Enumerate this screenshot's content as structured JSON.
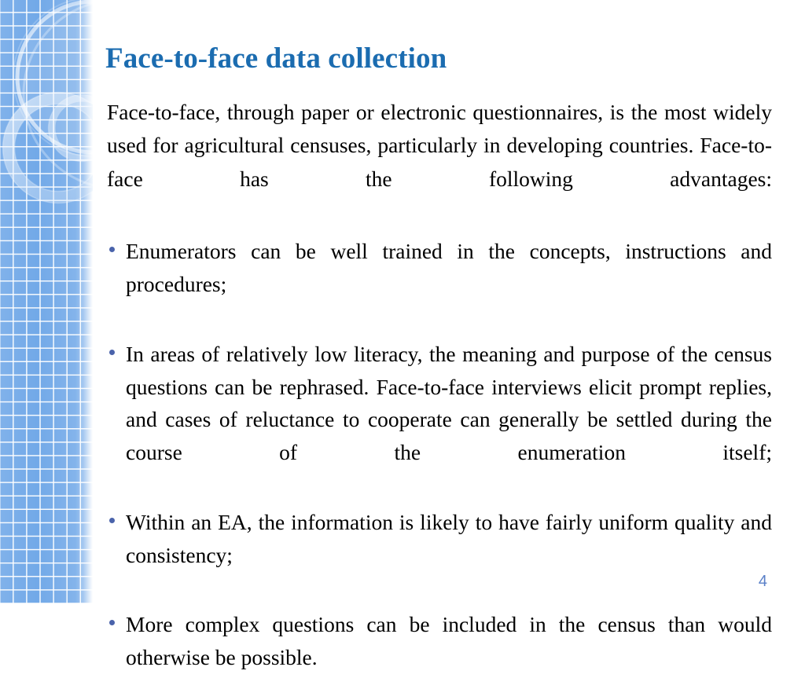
{
  "slide": {
    "title": "Face-to-face data collection",
    "page_number": "4",
    "colors": {
      "title_blue": "#1b6cb0",
      "bullet_marker": "#4a63ab",
      "page_number": "#5a80c8",
      "sidebar_grid_blue": "#72a9e8",
      "sidebar_grid_line": "#ffffff",
      "body_text": "#000000",
      "background": "#ffffff"
    },
    "intro_paragraph": "Face-to-face, through paper or electronic questionnaires, is the most widely used for agricultural censuses, particularly in developing countries. Face-to-face has the following advantages:",
    "bullets": [
      {
        "text": "Enumerators can be well trained in the concepts, instructions and procedures;"
      },
      {
        "text": "In areas of relatively low literacy, the meaning and purpose of the census questions can be rephrased. Face-to-face interviews elicit prompt replies, and cases of reluctance to cooperate can generally be settled during the course of the enumeration itself;"
      },
      {
        "text": "Within an EA, the information is likely to have fairly uniform quality and consistency;"
      },
      {
        "text": "More complex questions can be included in the census than would otherwise be possible."
      }
    ],
    "decoration": {
      "name": "grid-and-rings-sidebar",
      "shapes": [
        "large-arc-circle",
        "ring-circle",
        "inner-ring-circle"
      ]
    }
  }
}
